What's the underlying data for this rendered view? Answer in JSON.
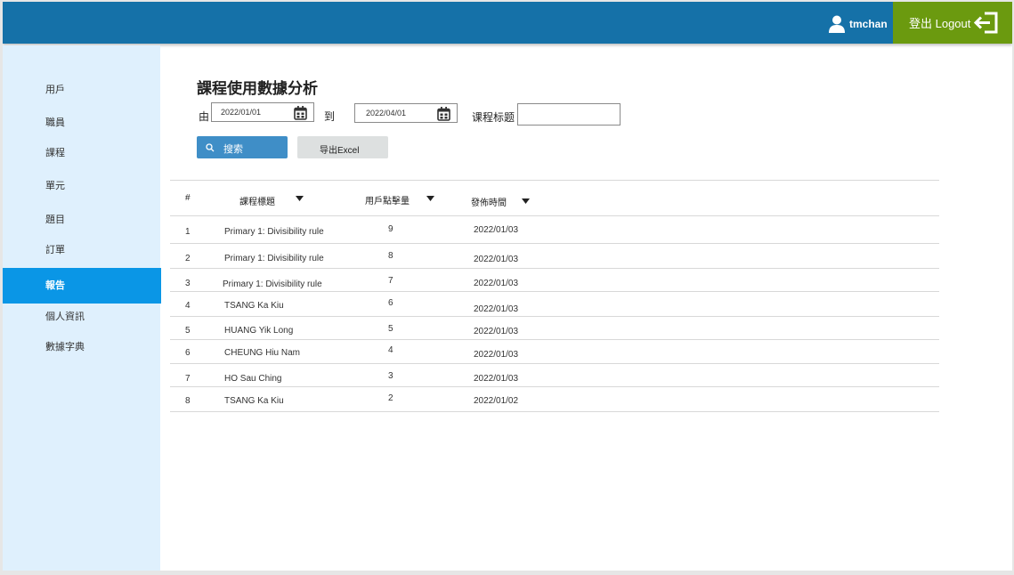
{
  "header": {
    "username": "tmchan",
    "logout_label": "登出 Logout",
    "bg_color": "#1571a8",
    "logout_color": "#6b9a0f"
  },
  "sidebar": {
    "items": [
      {
        "label": "用戶"
      },
      {
        "label": "職員"
      },
      {
        "label": "課程"
      },
      {
        "label": "單元"
      },
      {
        "label": "題目"
      },
      {
        "label": "訂單"
      },
      {
        "label": "報告",
        "active": true
      },
      {
        "label": "個人資訊"
      },
      {
        "label": "數據字典"
      }
    ],
    "active_color": "#0a96e6"
  },
  "main": {
    "title": "課程使用數據分析",
    "filter": {
      "from_label": "由",
      "from_value": "2022/01/01",
      "to_label": "到",
      "to_value": "2022/04/01",
      "course_title_label": "课程标题",
      "course_title_value": ""
    },
    "buttons": {
      "search_label": "搜索",
      "export_label": "导出Excel"
    },
    "table": {
      "columns": [
        "#",
        "課程標題",
        "用戶點擊量",
        "發佈時間"
      ],
      "rows": [
        {
          "idx": "1",
          "title": "Primary 1: Divisibility rule",
          "clicks": "9",
          "date": "2022/01/03"
        },
        {
          "idx": "2",
          "title": "Primary 1: Divisibility rule",
          "clicks": "8",
          "date": "2022/01/03"
        },
        {
          "idx": "3",
          "title": "Primary 1: Divisibility rule",
          "clicks": "7",
          "date": "2022/01/03"
        },
        {
          "idx": "4",
          "title": "TSANG Ka Kiu",
          "clicks": "6",
          "date": "2022/01/03"
        },
        {
          "idx": "5",
          "title": "HUANG Yik Long",
          "clicks": "5",
          "date": "2022/01/03"
        },
        {
          "idx": "6",
          "title": "CHEUNG Hiu Nam",
          "clicks": "4",
          "date": "2022/01/03"
        },
        {
          "idx": "7",
          "title": "HO Sau Ching",
          "clicks": "3",
          "date": "2022/01/03"
        },
        {
          "idx": "8",
          "title": "TSANG Ka Kiu",
          "clicks": "2",
          "date": "2022/01/02"
        }
      ]
    }
  }
}
